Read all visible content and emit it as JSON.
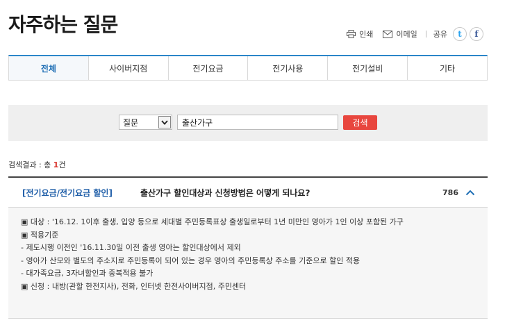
{
  "header": {
    "title": "자주하는 질문"
  },
  "utility": {
    "print_label": "인쇄",
    "email_label": "이메일",
    "share_label": "공유",
    "twitter_glyph": "t",
    "facebook_glyph": "f"
  },
  "tabs": [
    {
      "label": "전체",
      "active": true
    },
    {
      "label": "사이버지점"
    },
    {
      "label": "전기요금"
    },
    {
      "label": "전기사용"
    },
    {
      "label": "전기설비"
    },
    {
      "label": "기타"
    }
  ],
  "search": {
    "type_selected": "질문",
    "query_value": "출산가구",
    "button_label": "검색"
  },
  "results": {
    "prefix": "검색결과 : 총 ",
    "count": "1",
    "suffix": "건"
  },
  "faq": {
    "category": "[전기요금/전기요금 할인]",
    "question": "출산가구 할인대상과 신청방법은 어떻게 되나요?",
    "views": "786",
    "answer_lines": [
      "▣ 대상 : '16.12. 1이후 출생, 입양 등으로 세대별 주민등록표상 출생일로부터 1년 미만인 영아가 1인 이상 포함된 가구",
      "▣ 적용기준",
      " - 제도시행 이전인 '16.11.30일 이전 출생 영아는 할인대상에서 제외",
      " - 영아가 산모와 별도의 주소지로 주민등록이 되어 있는 경우 영아의 주민등록상 주소를 기준으로 할인 적용",
      " - 대가족요금, 3자녀할인과 중복적용 불가",
      "▣ 신청 : 내방(관할 한전지사), 전화, 인터넷 한전사이버지점, 주민센터"
    ]
  },
  "colors": {
    "accent": "#2b86c9",
    "category_blue": "#1f5ea8",
    "search_button": "#e8463e",
    "count_red": "#d8322a"
  }
}
